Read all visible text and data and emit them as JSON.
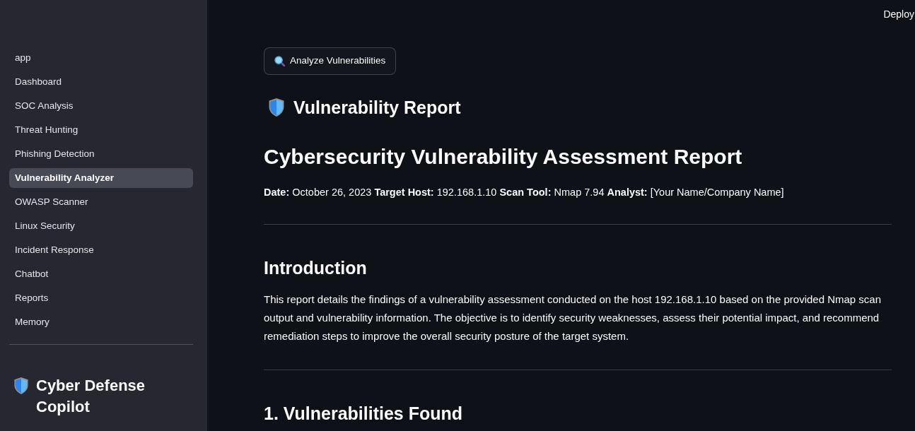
{
  "header": {
    "deploy_button": "Deploy"
  },
  "sidebar": {
    "nav_items": [
      {
        "label": "app",
        "selected": false
      },
      {
        "label": "Dashboard",
        "selected": false
      },
      {
        "label": "SOC Analysis",
        "selected": false
      },
      {
        "label": "Threat Hunting",
        "selected": false
      },
      {
        "label": "Phishing Detection",
        "selected": false
      },
      {
        "label": "Vulnerability Analyzer",
        "selected": true
      },
      {
        "label": "OWASP Scanner",
        "selected": false
      },
      {
        "label": "Linux Security",
        "selected": false
      },
      {
        "label": "Incident Response",
        "selected": false
      },
      {
        "label": "Chatbot",
        "selected": false
      },
      {
        "label": "Reports",
        "selected": false
      },
      {
        "label": "Memory",
        "selected": false
      }
    ],
    "title": "Cyber Defense Copilot"
  },
  "main": {
    "analyze_button": "Analyze Vulnerabilities",
    "subheader": "Vulnerability Report",
    "report": {
      "title": "Cybersecurity Vulnerability Assessment Report",
      "meta": "**Date:** October 26, 2023 **Target Host:** 192.168.1.10 **Scan Tool:** Nmap 7.94 **Analyst:** [Your Name/Company Name]",
      "sections": [
        {
          "heading": "Introduction",
          "text": "This report details the findings of a vulnerability assessment conducted on the host 192.168.1.10 based on the provided Nmap scan output and vulnerability information. The objective is to identify security weaknesses, assess their potential impact, and recommend remediation steps to improve the overall security posture of the target system."
        },
        {
          "heading": "1. Vulnerabilities Found"
        }
      ]
    }
  }
}
